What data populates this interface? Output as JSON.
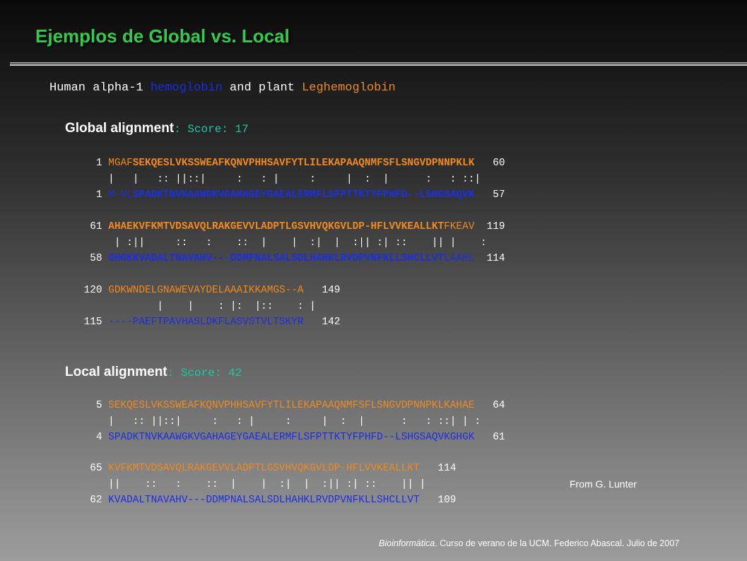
{
  "title": "Ejemplos de Global vs. Local",
  "subtitle": {
    "prefix": "Human alpha-1 ",
    "hemoglobin": "hemoglobin",
    "middle": " and plant ",
    "leghemoglobin": "Leghemoglobin"
  },
  "global": {
    "heading": "Global alignment",
    "sep": ": ",
    "score": "Score: 17",
    "blocks": [
      {
        "n1": "   1 ",
        "s1a": "MGAF",
        "s1b": "SEKQESLVKSSWEAFKQNVPHHSAVFYTLILEKAPAAQNMFSFLSNGVDPNNPKLK",
        "e1": "   60",
        "mid": "     |   |   :: ||::|     :   : |     :     |  :  |      :   : ::|",
        "n2": "   1 ",
        "s2a": "M-VL",
        "s2b": "SPADKTNVKAAWGKVGAHAGEYGAEALERMFLSFPTTKTYFPHFD--LSHGSAQVK",
        "e2": "   57"
      },
      {
        "n1": "  61 ",
        "s1a": "AHAEKVFKMTVDSAVQLRAKGEVVLADPTLGSVHVQKGVLDP-HFLVVKEALLKT",
        "s1b": "FKEAV",
        "e1": "  119",
        "mid": "      | :||     ::   :    ::  |    |  :|  |  :|| :| ::    || |    :",
        "n2": "  58 ",
        "s2a": "GHGKKVADALTNAVAHV---DDMPNALSALSDLHAHKLRVDPVNFKLLSHCLLVT",
        "s2b": "LAAHL",
        "e2": "  114"
      },
      {
        "n1": " 120 ",
        "s1": "GDKWNDELGNAWEVAYDELAAAIKKAMGS--A",
        "e1": "   149",
        "mid": "             |    |    : |:  |::    : |",
        "n2": " 115 ",
        "s2": "----PAEFTPAVHASLDKFLASVSTVLTSKYR",
        "e2": "   142"
      }
    ]
  },
  "local": {
    "heading": "Local alignment",
    "sep": ": ",
    "score": "Score: 42",
    "blocks": [
      {
        "n1": "   5 ",
        "s1": "SEKQESLVKSSWEAFKQNVPHHSAVFYTLILEKAPAAQNMFSFLSNGVDPNNPKLKAHAE",
        "e1": "   64",
        "mid": "     |   :: ||::|     :   : |     :     |  :  |      :   : ::| | :",
        "n2": "   4 ",
        "s2": "SPADKTNVKAAWGKVGAHAGEYGAEALERMFLSFPTTKTYFPHFD--LSHGSAQVKGHGK",
        "e2": "   61"
      },
      {
        "n1": "  65 ",
        "s1": "KVFKMTVDSAVQLRAKGEVVLADPTLGSVHVQKGVLDP-HFLVVKEALLKT",
        "e1": "   114",
        "mid": "     ||    ::   :    ::  |    |  :|  |  :|| :| ::    || |",
        "n2": "  62 ",
        "s2": "KVADALTNAVAHV---DDMPNALSALSDLHAHKLRVDPVNFKLLSHCLLVT",
        "e2": "   109"
      }
    ]
  },
  "credit": "From G. Lunter",
  "footer": {
    "italic": "Bioinformática",
    "rest": ". Curso de verano de la UCM. Federico Abascal. Julio de 2007"
  },
  "colors": {
    "title": "#33cc4a",
    "sequence_orange": "#f08a1e",
    "sequence_blue": "#1a2ee6",
    "score": "#17c9a6"
  }
}
